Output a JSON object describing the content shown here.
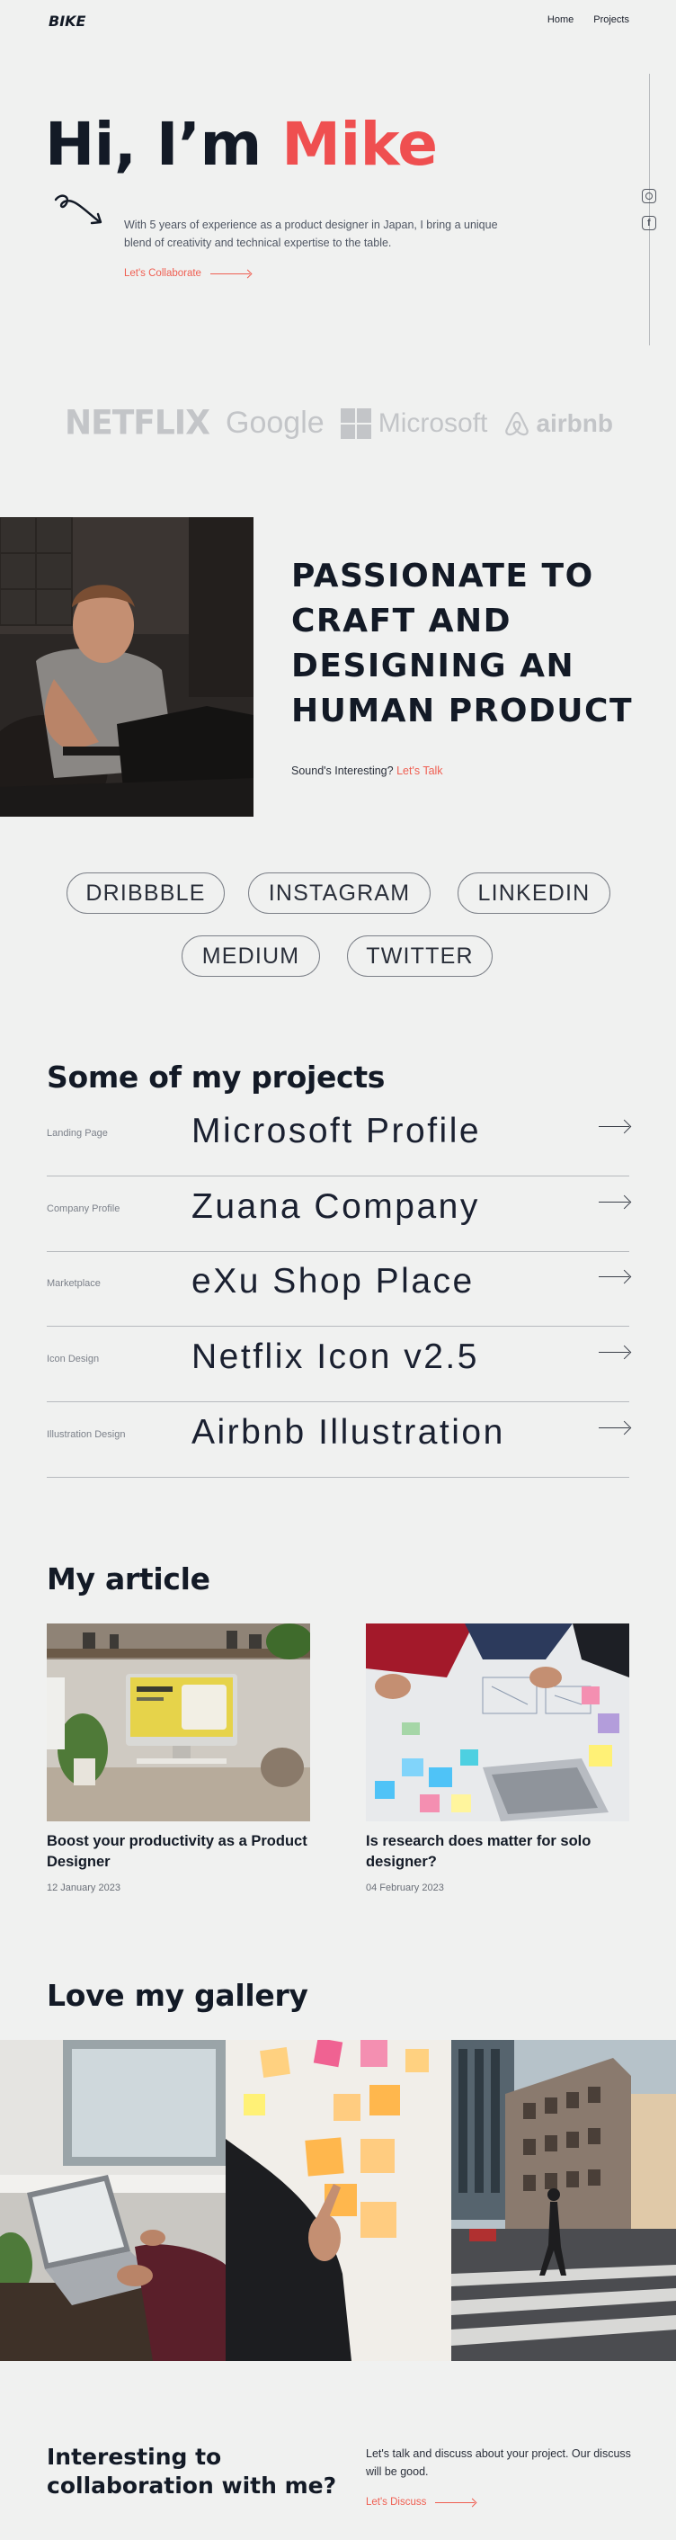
{
  "nav": {
    "logo_text": "BIKE",
    "items": [
      "Home",
      "Projects"
    ]
  },
  "hero": {
    "greeting": "Hi, I’m ",
    "name": "Mike",
    "description": "With 5 years of experience as a product designer in Japan, I bring a unique blend of creativity and technical expertise to the table.",
    "cta": "Let's Collaborate"
  },
  "social_icons": [
    "instagram-icon",
    "facebook-icon"
  ],
  "brands": [
    "NETFLIX",
    "Google",
    "Microsoft",
    "airbnb"
  ],
  "passion": {
    "title_lines": [
      "PASSIONATE TO",
      "CRAFT AND",
      "DESIGNING AN",
      "HUMAN PRODUCT"
    ],
    "sub": "Sound's Interesting? ",
    "sub_link": "Let's Talk"
  },
  "pills": [
    "DRIBBBLE",
    "INSTAGRAM",
    "LINKEDIN",
    "MEDIUM",
    "TWITTER"
  ],
  "projects": {
    "title": "Some of my projects",
    "items": [
      {
        "category": "Landing Page",
        "name": "Microsoft Profile"
      },
      {
        "category": "Company Profile",
        "name": "Zuana Company"
      },
      {
        "category": "Marketplace",
        "name": "eXu Shop Place"
      },
      {
        "category": "Icon Design",
        "name": "Netflix Icon v2.5"
      },
      {
        "category": "Illustration Design",
        "name": "Airbnb Illustration"
      }
    ]
  },
  "articles": {
    "title": "My article",
    "items": [
      {
        "title": "Boost your productivity as a Product Designer",
        "date": "12 January 2023"
      },
      {
        "title": "Is research does matter for solo designer?",
        "date": "04 February 2023"
      }
    ]
  },
  "gallery": {
    "title": "Love my gallery"
  },
  "footer": {
    "title": "Interesting to collaboration with me?",
    "description": "Let's talk and discuss about your project. Our discuss will be good.",
    "cta": "Let's Discuss"
  },
  "colors": {
    "accent": "#ef4f50",
    "background": "#f0f1f0",
    "text": "#131a26"
  }
}
